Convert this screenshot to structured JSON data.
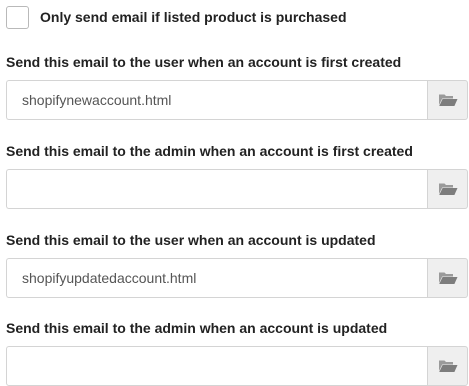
{
  "purchase_condition": {
    "label": "Only send email if listed product is purchased",
    "checked": false
  },
  "fields": [
    {
      "label": "Send this email to the user when an account is first created",
      "value": "shopifynewaccount.html",
      "browse_icon": "folder-open-icon"
    },
    {
      "label": "Send this email to the admin when an account is first created",
      "value": "",
      "browse_icon": "folder-open-icon"
    },
    {
      "label": "Send this email to the user when an account is updated",
      "value": "shopifyupdatedaccount.html",
      "browse_icon": "folder-open-icon"
    },
    {
      "label": "Send this email to the admin when an account is updated",
      "value": "",
      "browse_icon": "folder-open-icon"
    }
  ]
}
